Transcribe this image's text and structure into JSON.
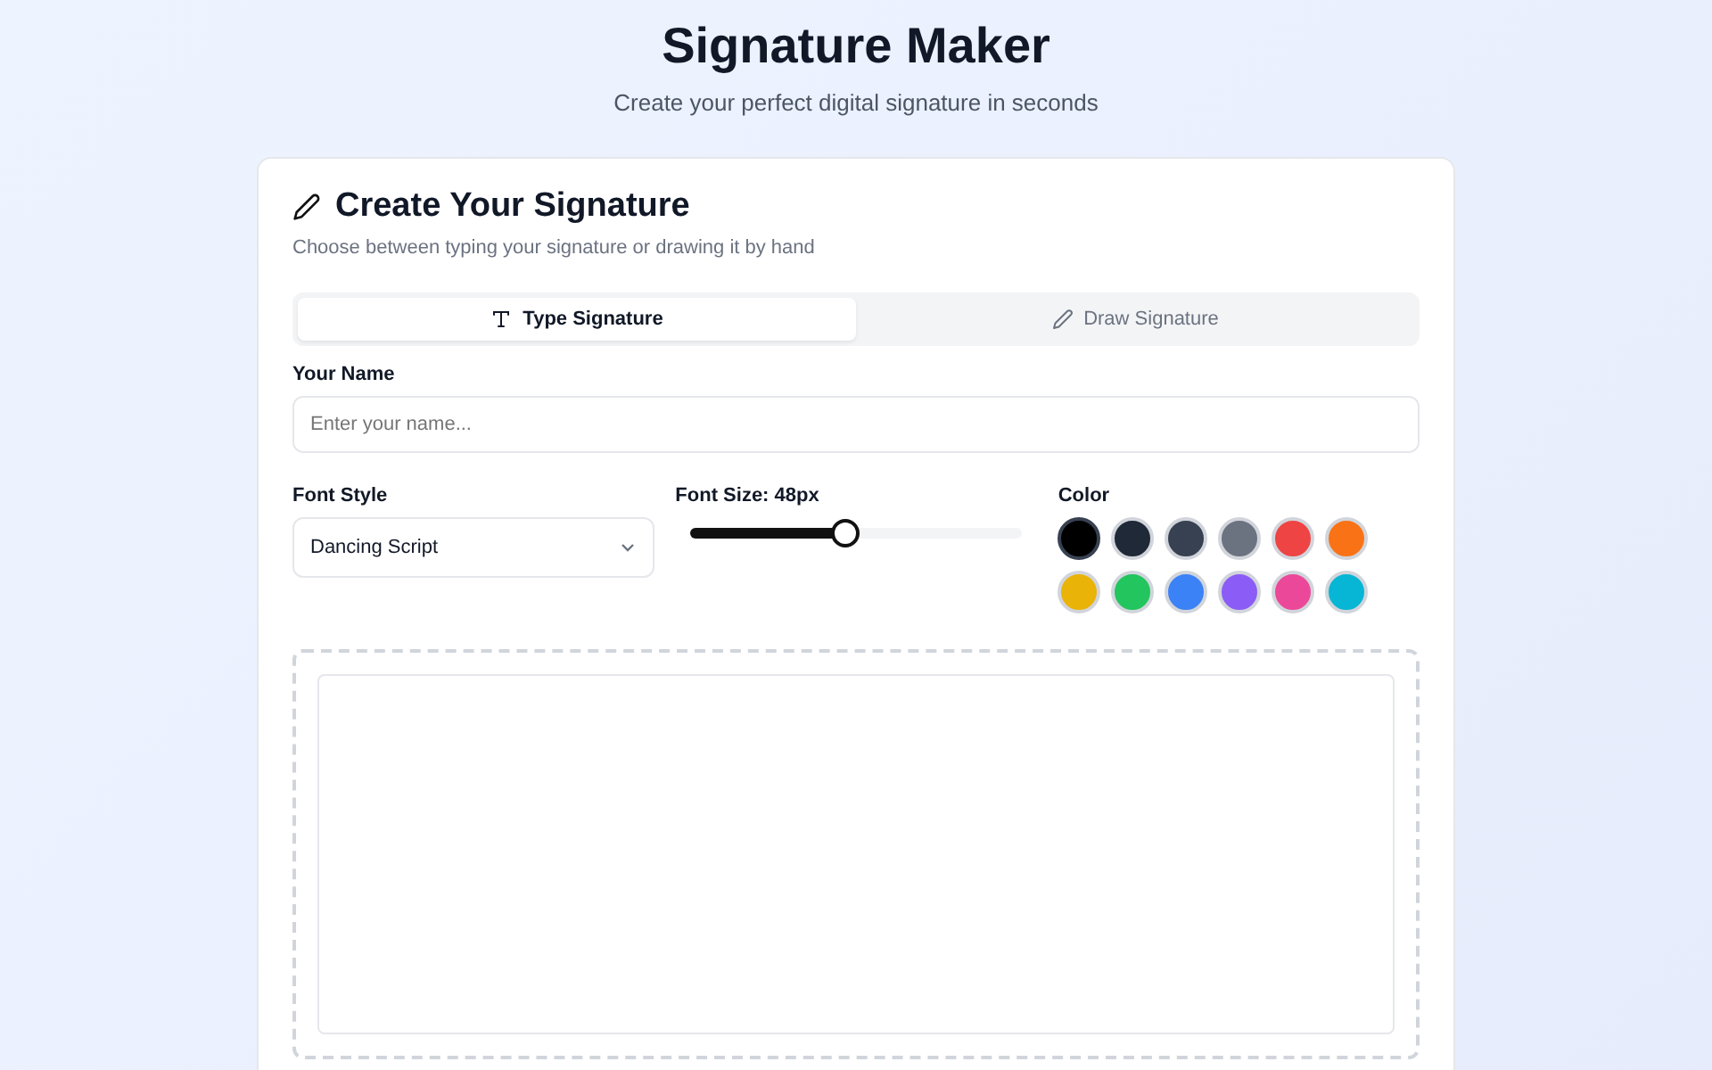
{
  "header": {
    "title": "Signature Maker",
    "subtitle": "Create your perfect digital signature in seconds"
  },
  "card": {
    "title": "Create Your Signature",
    "description": "Choose between typing your signature or drawing it by hand"
  },
  "tabs": [
    {
      "label": "Type Signature",
      "kind": "type",
      "selected": true
    },
    {
      "label": "Draw Signature",
      "kind": "draw",
      "selected": false
    }
  ],
  "name_field": {
    "label": "Your Name",
    "placeholder": "Enter your name..."
  },
  "font_style": {
    "label": "Font Style",
    "value": "Dancing Script"
  },
  "font_size": {
    "label": "Font Size: 48px",
    "level": 0.47
  },
  "color": {
    "label": "Color",
    "swatches": [
      {
        "color": "#000000",
        "selected": true
      },
      {
        "color": "#1f2937",
        "selected": false
      },
      {
        "color": "#374151",
        "selected": false
      },
      {
        "color": "#6b7280",
        "selected": false
      },
      {
        "color": "#ef4444",
        "selected": false
      },
      {
        "color": "#f97316",
        "selected": false
      },
      {
        "color": "#eab308",
        "selected": false
      },
      {
        "color": "#22c55e",
        "selected": false
      },
      {
        "color": "#3b82f6",
        "selected": false
      },
      {
        "color": "#8b5cf6",
        "selected": false
      },
      {
        "color": "#ec4899",
        "selected": false
      },
      {
        "color": "#06b6d4",
        "selected": false
      }
    ]
  }
}
